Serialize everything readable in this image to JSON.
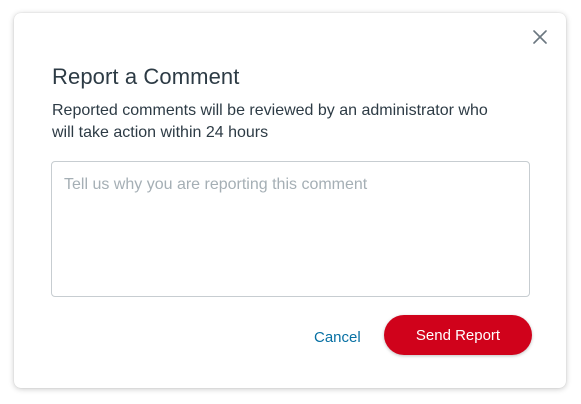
{
  "dialog": {
    "title": "Report a Comment",
    "description": "Reported comments will be reviewed by an administrator who will take action within 24 hours",
    "reason_field": {
      "value": "",
      "placeholder": "Tell us why you are reporting this comment"
    },
    "cancel_label": "Cancel",
    "send_label": "Send Report",
    "close_icon": "close-icon"
  },
  "colors": {
    "primary_button": "#d0021b",
    "link": "#0770a3",
    "text": "#2d3b45",
    "placeholder": "#a5afb5",
    "border": "#c7cdd1"
  }
}
